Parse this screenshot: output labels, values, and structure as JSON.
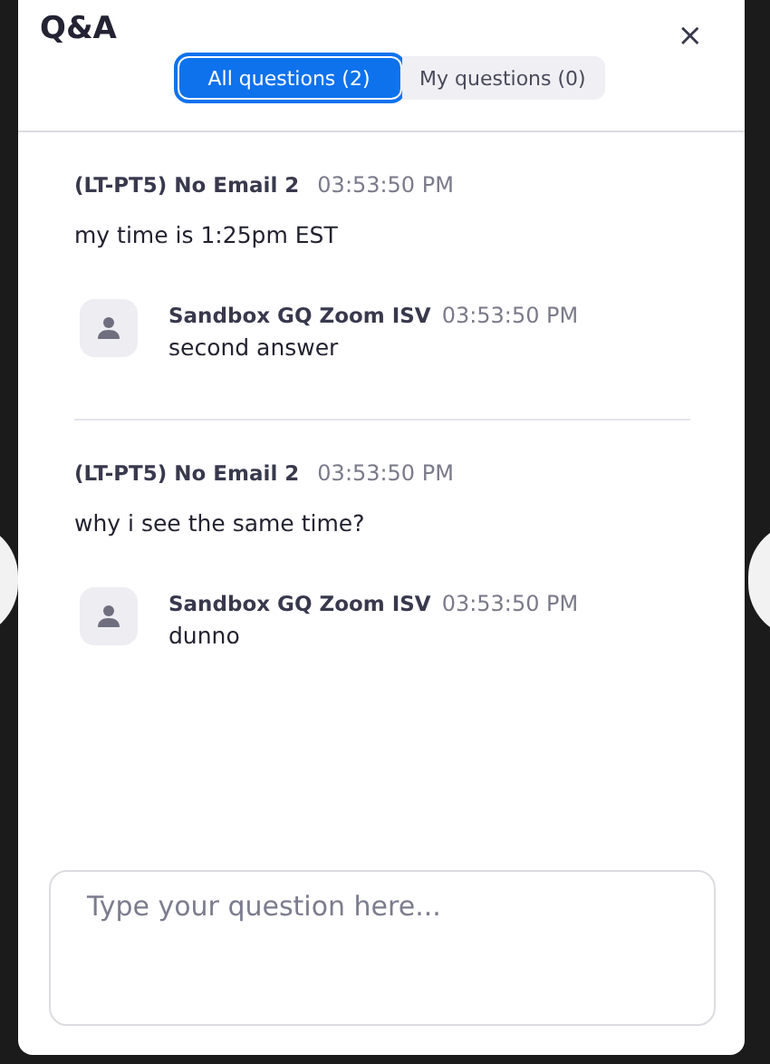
{
  "window": {
    "title": "Q&A",
    "close": "×"
  },
  "tabs": [
    {
      "label": "All questions (2)",
      "selected": true
    },
    {
      "label": "My questions (0)",
      "selected": false
    }
  ],
  "questions": [
    {
      "author": "(LT-PT5) No Email 2",
      "time": "03:53:50 PM",
      "text": "my time is 1:25pm EST",
      "answers": [
        {
          "author": "Sandbox GQ Zoom ISV",
          "time": "03:53:50 PM",
          "text": "second answer"
        }
      ]
    },
    {
      "author": "(LT-PT5) No Email 2",
      "time": "03:53:50 PM",
      "text": "why i see the same time?",
      "answers": [
        {
          "author": "Sandbox GQ Zoom ISV",
          "time": "03:53:50 PM",
          "text": "dunno"
        }
      ]
    }
  ],
  "input": {
    "placeholder": "Type your question here..."
  }
}
